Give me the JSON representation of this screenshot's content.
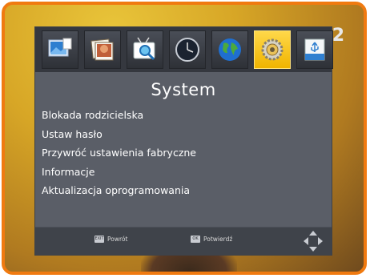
{
  "channel_logo": "2",
  "toolbar": {
    "tiles": [
      {
        "icon": "picture-settings-icon"
      },
      {
        "icon": "media-gallery-icon"
      },
      {
        "icon": "channel-search-icon"
      },
      {
        "icon": "clock-icon"
      },
      {
        "icon": "globe-icon"
      },
      {
        "icon": "system-settings-icon",
        "active": true
      },
      {
        "icon": "usb-icon"
      }
    ],
    "active_color": "#f5c518"
  },
  "menu": {
    "title": "System",
    "items": [
      "Blokada rodzicielska",
      "Ustaw hasło",
      "Przywróć ustawienia fabryczne",
      "Informacje",
      "Aktualizacja oprogramowania"
    ]
  },
  "footer": {
    "back_key": "EXIT",
    "back_label": "Powrót",
    "ok_key": "OK",
    "ok_label": "Potwierdź",
    "nav_icon": "navigation-arrows-icon"
  },
  "colors": {
    "frame": "#f07a10",
    "panel": "#5a5e67",
    "icon_bar": "#35383f",
    "footer": "#3f434a"
  }
}
